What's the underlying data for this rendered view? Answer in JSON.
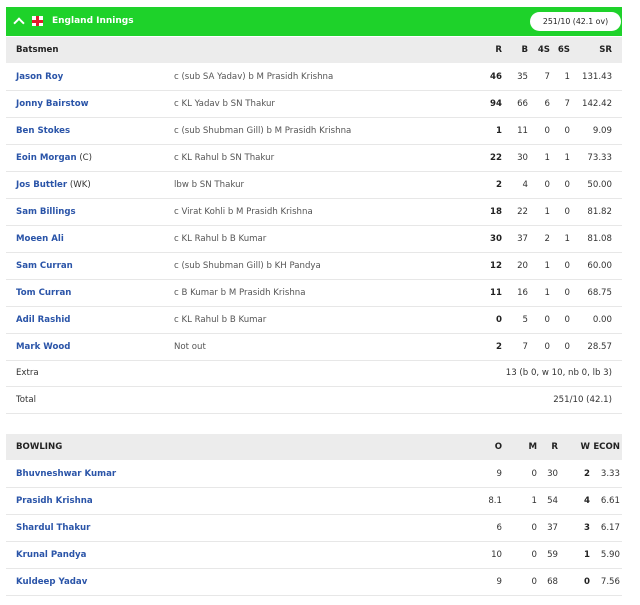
{
  "innings": {
    "title": "England Innings",
    "score": "251/10 (42.1 ov)"
  },
  "batting": {
    "headers": {
      "batsmen": "Batsmen",
      "r": "R",
      "b": "B",
      "fours": "4S",
      "sixes": "6S",
      "sr": "SR"
    },
    "rows": [
      {
        "name": "Jason Roy",
        "role": "",
        "dismissal": "c (sub SA Yadav) b M Prasidh Krishna",
        "r": "46",
        "b": "35",
        "fours": "7",
        "sixes": "1",
        "sr": "131.43"
      },
      {
        "name": "Jonny Bairstow",
        "role": "",
        "dismissal": "c KL Yadav b SN Thakur",
        "r": "94",
        "b": "66",
        "fours": "6",
        "sixes": "7",
        "sr": "142.42"
      },
      {
        "name": "Ben Stokes",
        "role": "",
        "dismissal": "c (sub Shubman Gill) b M Prasidh Krishna",
        "r": "1",
        "b": "11",
        "fours": "0",
        "sixes": "0",
        "sr": "9.09"
      },
      {
        "name": "Eoin Morgan",
        "role": "(C)",
        "dismissal": "c KL Rahul b SN Thakur",
        "r": "22",
        "b": "30",
        "fours": "1",
        "sixes": "1",
        "sr": "73.33"
      },
      {
        "name": "Jos Buttler",
        "role": "(WK)",
        "dismissal": "lbw b SN Thakur",
        "r": "2",
        "b": "4",
        "fours": "0",
        "sixes": "0",
        "sr": "50.00"
      },
      {
        "name": "Sam Billings",
        "role": "",
        "dismissal": "c Virat Kohli b M Prasidh Krishna",
        "r": "18",
        "b": "22",
        "fours": "1",
        "sixes": "0",
        "sr": "81.82"
      },
      {
        "name": "Moeen Ali",
        "role": "",
        "dismissal": "c KL Rahul b B Kumar",
        "r": "30",
        "b": "37",
        "fours": "2",
        "sixes": "1",
        "sr": "81.08"
      },
      {
        "name": "Sam Curran",
        "role": "",
        "dismissal": "c (sub Shubman Gill) b KH Pandya",
        "r": "12",
        "b": "20",
        "fours": "1",
        "sixes": "0",
        "sr": "60.00"
      },
      {
        "name": "Tom Curran",
        "role": "",
        "dismissal": "c B Kumar b M Prasidh Krishna",
        "r": "11",
        "b": "16",
        "fours": "1",
        "sixes": "0",
        "sr": "68.75"
      },
      {
        "name": "Adil Rashid",
        "role": "",
        "dismissal": "c KL Rahul b B Kumar",
        "r": "0",
        "b": "5",
        "fours": "0",
        "sixes": "0",
        "sr": "0.00"
      },
      {
        "name": "Mark Wood",
        "role": "",
        "dismissal": "Not out",
        "r": "2",
        "b": "7",
        "fours": "0",
        "sixes": "0",
        "sr": "28.57"
      }
    ],
    "extra": {
      "label": "Extra",
      "value": "13 (b 0, w 10, nb 0, lb 3)"
    },
    "total": {
      "label": "Total",
      "value": "251/10 (42.1)"
    }
  },
  "bowling": {
    "headers": {
      "bowling": "BOWLING",
      "o": "O",
      "m": "M",
      "r": "R",
      "w": "W",
      "econ": "ECON"
    },
    "rows": [
      {
        "name": "Bhuvneshwar Kumar",
        "o": "9",
        "m": "0",
        "r": "30",
        "w": "2",
        "econ": "3.33"
      },
      {
        "name": "Prasidh Krishna",
        "o": "8.1",
        "m": "1",
        "r": "54",
        "w": "4",
        "econ": "6.61"
      },
      {
        "name": "Shardul Thakur",
        "o": "6",
        "m": "0",
        "r": "37",
        "w": "3",
        "econ": "6.17"
      },
      {
        "name": "Krunal Pandya",
        "o": "10",
        "m": "0",
        "r": "59",
        "w": "1",
        "econ": "5.90"
      },
      {
        "name": "Kuldeep Yadav",
        "o": "9",
        "m": "0",
        "r": "68",
        "w": "0",
        "econ": "7.56"
      }
    ]
  }
}
